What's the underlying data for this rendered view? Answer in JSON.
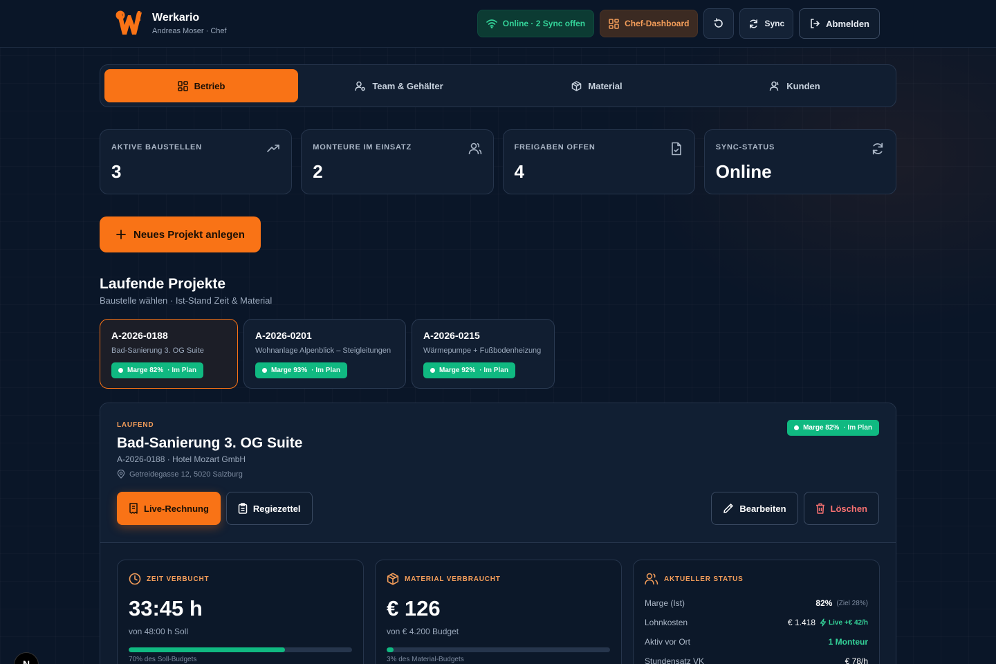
{
  "app": {
    "name": "Werkario",
    "user_line": "Andreas Moser · Chef"
  },
  "topbar": {
    "online_label": "Online · 2 Sync offen",
    "chef_label": "Chef-Dashboard",
    "sync_label": "Sync",
    "logout_label": "Abmelden"
  },
  "tabs": [
    {
      "label": "Betrieb",
      "icon": "grid-icon",
      "active": true
    },
    {
      "label": "Team & Gehälter",
      "icon": "user-settings-icon",
      "active": false
    },
    {
      "label": "Material",
      "icon": "box-icon",
      "active": false
    },
    {
      "label": "Kunden",
      "icon": "users-icon",
      "active": false
    }
  ],
  "kpis": [
    {
      "label": "AKTIVE BAUSTELLEN",
      "value": "3",
      "icon": "trending-up-icon"
    },
    {
      "label": "MONTEURE IM EINSATZ",
      "value": "2",
      "icon": "users-icon"
    },
    {
      "label": "FREIGABEN OFFEN",
      "value": "4",
      "icon": "file-check-icon"
    },
    {
      "label": "SYNC-STATUS",
      "value": "Online",
      "icon": "refresh-icon"
    }
  ],
  "new_project_label": "Neues Projekt anlegen",
  "projects_section": {
    "title": "Laufende Projekte",
    "subtitle": "Baustelle wählen · Ist-Stand Zeit & Material"
  },
  "projects": [
    {
      "id": "A-2026-0188",
      "name": "Bad-Sanierung 3. OG Suite",
      "marge": "Marge 82%",
      "plan": "· Im Plan",
      "active": true
    },
    {
      "id": "A-2026-0201",
      "name": "Wohnanlage Alpenblick – Steigleitungen",
      "marge": "Marge 93%",
      "plan": "· Im Plan",
      "active": false
    },
    {
      "id": "A-2026-0215",
      "name": "Wärmepumpe + Fußbodenheizung",
      "marge": "Marge 92%",
      "plan": "· Im Plan",
      "active": false
    }
  ],
  "detail": {
    "status": "LAUFEND",
    "title": "Bad-Sanierung 3. OG Suite",
    "meta": "A-2026-0188 · Hotel Mozart GmbH",
    "address": "Getreidegasse 12, 5020 Salzburg",
    "marge": "Marge 82%",
    "plan": "· Im Plan",
    "buttons": {
      "live_invoice": "Live-Rechnung",
      "regiezettel": "Regiezettel",
      "edit": "Bearbeiten",
      "delete": "Löschen"
    },
    "time": {
      "label": "ZEIT VERBUCHT",
      "value": "33:45 h",
      "sub": "von 48:00 h Soll",
      "progress": 0.7,
      "caption": "70% des Soll-Budgets"
    },
    "material": {
      "label": "MATERIAL VERBRAUCHT",
      "value": "€ 126",
      "sub": "von € 4.200 Budget",
      "progress": 0.03,
      "caption": "3% des Material-Budgets"
    },
    "status_card": {
      "label": "AKTUELLER STATUS",
      "rows": {
        "marge_k": "Marge (Ist)",
        "marge_v": "82%",
        "marge_target": "(Ziel 28%)",
        "lohn_k": "Lohnkosten",
        "lohn_v": "€ 1.418",
        "lohn_live": "Live +€ 42/h",
        "aktiv_k": "Aktiv vor Ort",
        "aktiv_v": "1 Monteur",
        "satz_k": "Stundensatz VK",
        "satz_v": "€ 78/h"
      }
    }
  },
  "corner_badge": "N",
  "colors": {
    "accent": "#f97316",
    "success": "#10b981",
    "background": "#0a1628"
  }
}
